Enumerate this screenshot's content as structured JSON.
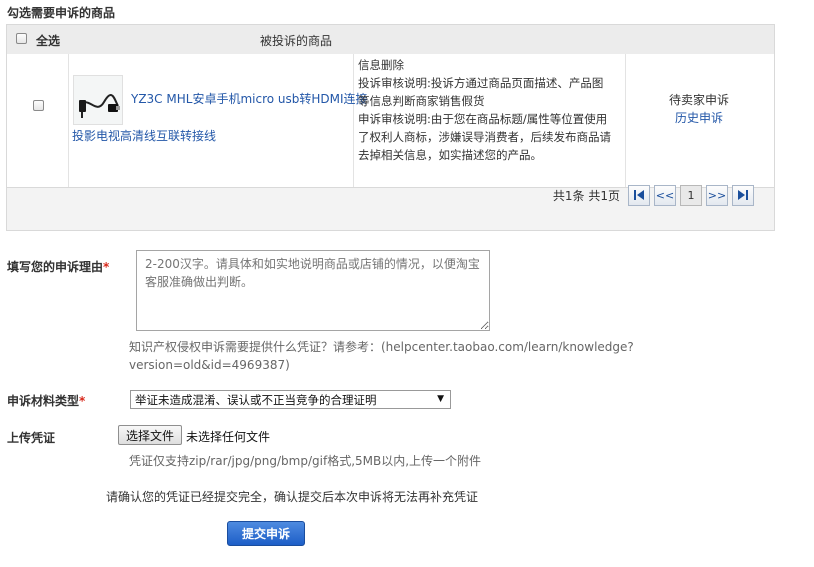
{
  "section_title": "勾选需要申诉的商品",
  "table": {
    "select_all_label": "全选",
    "product_header": "被投诉的商品",
    "row": {
      "product_title_line1": "YZ3C MHL安卓手机micro usb转HDMI连接",
      "product_title_line2": "投影电视高清线互联转接线",
      "info_lines": [
        "信息删除",
        "投诉审核说明:投诉方通过商品页面描述、产品图",
        "等信息判断商家销售假货",
        "申诉审核说明:由于您在商品标题/属性等位置使用",
        "了权利人商标，涉嫌误导消费者，后续发布商品请",
        "去掉相关信息，如实描述您的产品。"
      ],
      "status": "待卖家申诉",
      "history_link": "历史申诉"
    },
    "pager": {
      "summary": "共1条 共1页",
      "first_icon": "first-page-icon",
      "prev": "<<",
      "current": "1",
      "next": ">>",
      "last_icon": "last-page-icon"
    }
  },
  "reason": {
    "label": "填写您的申诉理由",
    "required_mark": "*",
    "placeholder": "2-200汉字。请具体和如实地说明商品或店铺的情况，以便淘宝客服准确做出判断。",
    "hint_line1": "知识产权侵权申诉需要提供什么凭证？请参考：(helpcenter.taobao.com/learn/knowledge?",
    "hint_line2": "version=old&id=4969387)"
  },
  "material_type": {
    "label": "申诉材料类型",
    "required_mark": "*",
    "selected": "举证未造成混淆、误认或不正当竞争的合理证明"
  },
  "upload": {
    "label": "上传凭证",
    "button": "选择文件",
    "no_file": "未选择任何文件",
    "hint": "凭证仅支持zip/rar/jpg/png/bmp/gif格式,5MB以内,上传一个附件"
  },
  "confirm_text": "请确认您的凭证已经提交完全，确认提交后本次申诉将无法再补充凭证",
  "submit_label": "提交申诉"
}
